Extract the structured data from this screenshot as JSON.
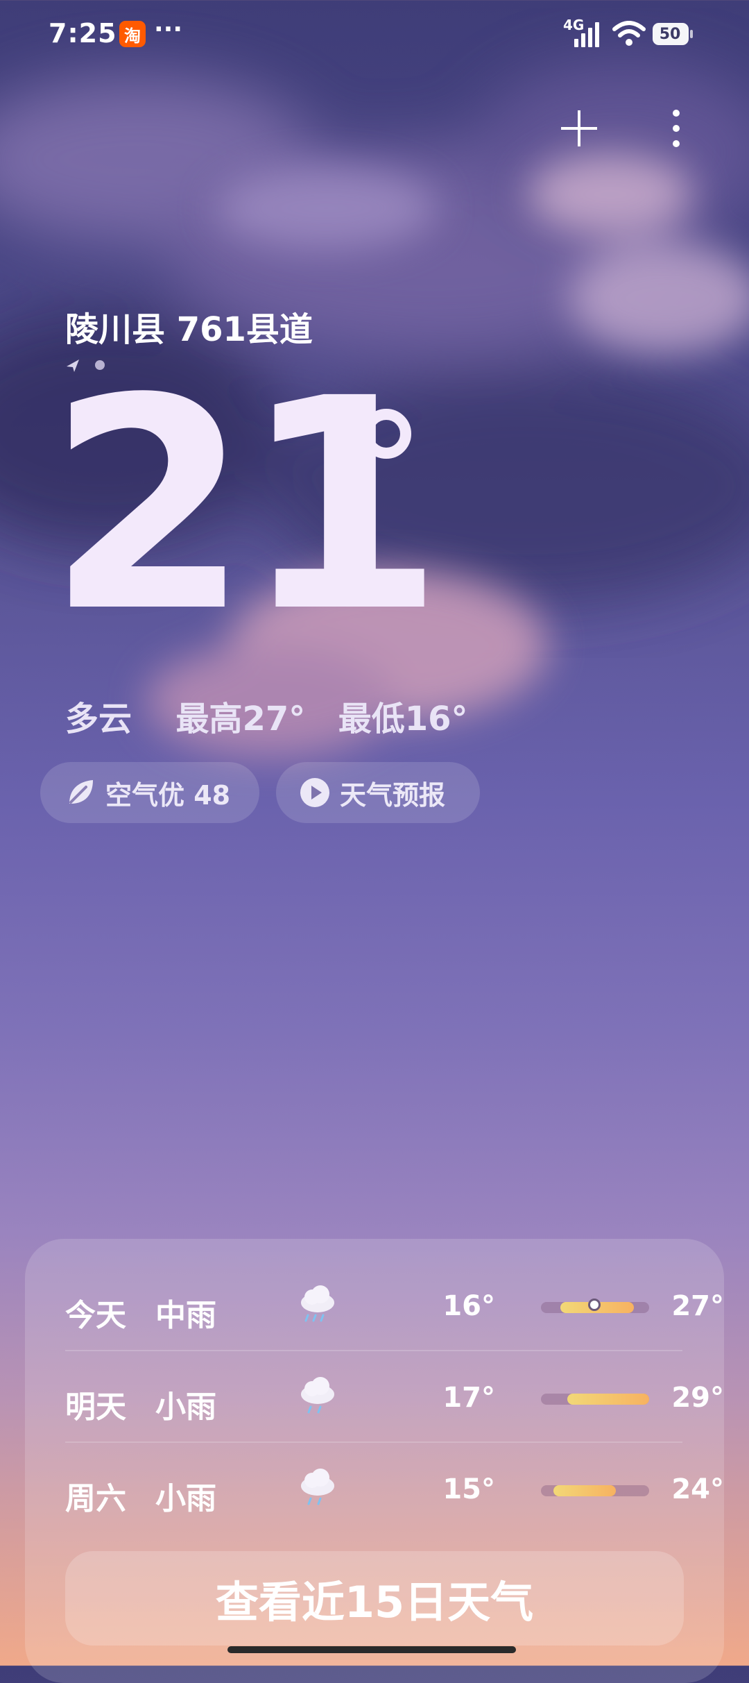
{
  "status_bar": {
    "time": "7:25",
    "app_badge": "淘",
    "more": "···",
    "network": "4G",
    "battery": "50"
  },
  "location": {
    "name": "陵川县 761县道"
  },
  "current": {
    "temperature": "21"
  },
  "summary": {
    "condition": "多云",
    "high": "最高27°",
    "low": "最低16°"
  },
  "pills": {
    "air_quality": "空气优 48",
    "forecast_video": "天气预报"
  },
  "forecast": [
    {
      "day": "今天",
      "condition": "中雨",
      "icon": "rain-cloud-icon",
      "low": "16°",
      "high": "27°"
    },
    {
      "day": "明天",
      "condition": "小雨",
      "icon": "rain-cloud-icon",
      "low": "17°",
      "high": "29°"
    },
    {
      "day": "周六",
      "condition": "小雨",
      "icon": "rain-cloud-icon",
      "low": "15°",
      "high": "24°"
    }
  ],
  "cta": {
    "label": "查看近15日天气"
  },
  "colors": {
    "accent_yellow": "#f2d877",
    "accent_orange": "#f7b261",
    "badge_orange": "#ff5a00"
  }
}
